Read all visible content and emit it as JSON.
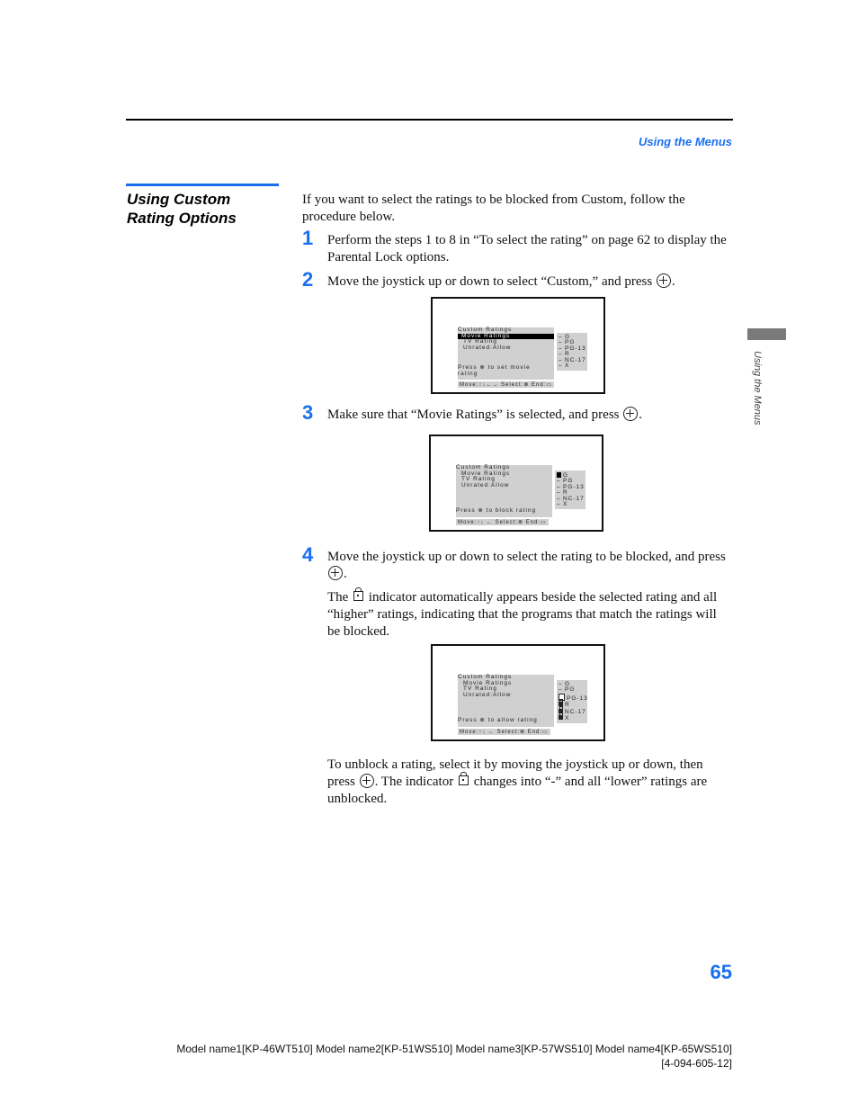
{
  "header": {
    "section_title": "Using the Menus"
  },
  "side_heading": {
    "line1": "Using Custom",
    "line2": "Rating Options"
  },
  "intro": "If you want to select the ratings to be blocked from Custom, follow the procedure below.",
  "steps": [
    {
      "num": "1",
      "text": "Perform the steps 1 to 8 in “To select the rating” on page 62 to display the Parental Lock options."
    },
    {
      "num": "2",
      "text_before": "Move the joystick up or down to select “Custom,” and press",
      "text_after": "."
    },
    {
      "num": "3",
      "text_before": "Make sure that “Movie Ratings” is selected, and press",
      "text_after": "."
    },
    {
      "num": "4",
      "text_before": "Move the joystick up or down to select the rating to be blocked, and press",
      "text_after": "."
    }
  ],
  "step4_note": {
    "before": "The",
    "after": "indicator automatically appears beside the selected rating and all “higher” ratings, indicating that the programs that match the ratings will be blocked."
  },
  "unblock_note": {
    "part1": "To unblock a rating, select it by moving the joystick up or down, then press",
    "part2": ". The indicator",
    "part3": "changes into “-” and all “lower” ratings are unblocked."
  },
  "screens": [
    {
      "menu": [
        "Custom Ratings",
        "Movie Ratings",
        "TV Rating",
        "Unrated:Allow"
      ],
      "highlighted": "Movie Ratings",
      "press_text": "Press ⊗ to set movie",
      "press_text2": "rating",
      "ratings": [
        {
          "mark": "-",
          "label": "G"
        },
        {
          "mark": "-",
          "label": "PG"
        },
        {
          "mark": "-",
          "label": "PG-13"
        },
        {
          "mark": "-",
          "label": "R"
        },
        {
          "mark": "-",
          "label": "NC-17"
        },
        {
          "mark": "-",
          "label": "X"
        }
      ],
      "footer": "Move:↑↓←→   Select:⊗   End:▭"
    },
    {
      "menu": [
        "Custom Ratings",
        "Movie Ratings",
        "TV Rating",
        "Unrated:Allow"
      ],
      "press_text": "Press ⊗ to block rating",
      "ratings": [
        {
          "mark": "cursor",
          "label": "G"
        },
        {
          "mark": "-",
          "label": "PG"
        },
        {
          "mark": "-",
          "label": "PG-13"
        },
        {
          "mark": "-",
          "label": "R"
        },
        {
          "mark": "-",
          "label": "NC-17"
        },
        {
          "mark": "-",
          "label": "X"
        }
      ],
      "footer": "Move:↑↓ ←   Select:⊗   End:▭"
    },
    {
      "menu": [
        "Custom Ratings",
        "Movie Ratings",
        "TV Rating",
        "Unrated:Allow"
      ],
      "press_text": "Press ⊗ to allow rating",
      "ratings": [
        {
          "mark": "-",
          "label": "G"
        },
        {
          "mark": "-",
          "label": "PG"
        },
        {
          "mark": "lock-selected",
          "label": "PG-13"
        },
        {
          "mark": "lock",
          "label": "R"
        },
        {
          "mark": "lock",
          "label": "NC-17"
        },
        {
          "mark": "lock",
          "label": "X"
        }
      ],
      "footer": "Move:↑↓ ←   Select:⊗   End:▭"
    }
  ],
  "side_tab_label": "Using the Menus",
  "page_number": "65",
  "footer": {
    "models": "Model name1[KP-46WT510] Model name2[KP-51WS510] Model name3[KP-57WS510] Model name4[KP-65WS510]",
    "code": "[4-094-605-12]"
  },
  "colors": {
    "accent_blue": "#1a6ff0",
    "side_tab_gray": "#7a7a7a",
    "screen_menu_gray": "#d0d0d0"
  }
}
